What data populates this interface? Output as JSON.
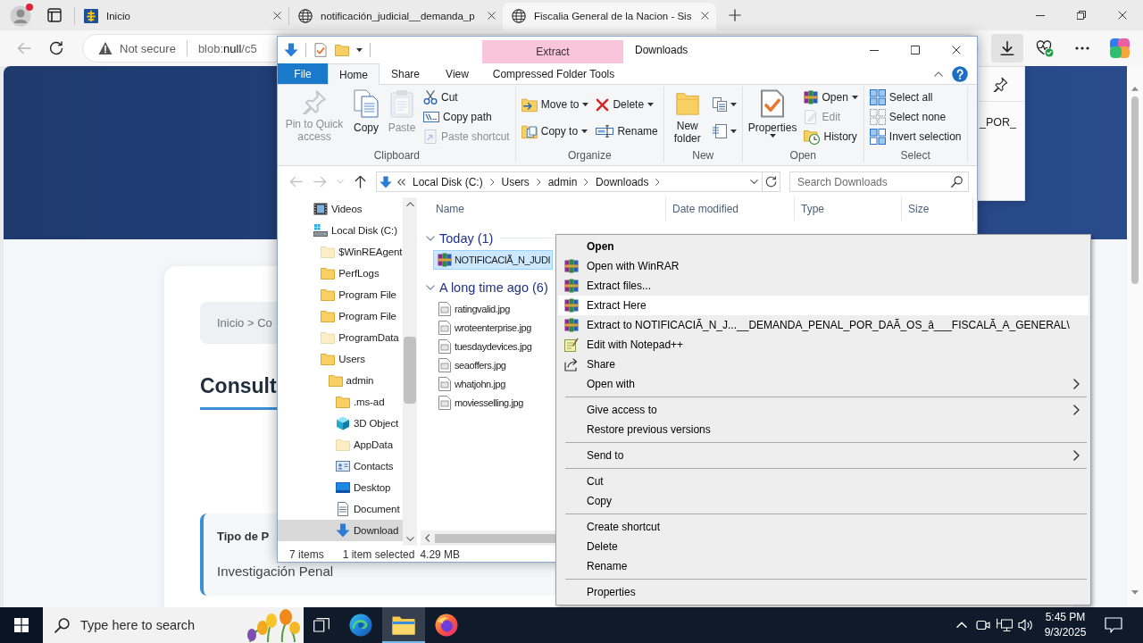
{
  "browser": {
    "tabs": [
      {
        "kind": "emblem",
        "title": "Inicio",
        "selected": false
      },
      {
        "kind": "globe",
        "title": "notificación_judicial__demanda_p",
        "selected": false
      },
      {
        "kind": "globe",
        "title": "Fiscalia General de la Nacion - Sis",
        "selected": true
      }
    ],
    "toolbar": {
      "back_disabled": true,
      "security": "Not secure",
      "url_prefix": "blob:",
      "url_host": "null",
      "url_rest": "/c5",
      "downloads_open": true
    },
    "download_flyout": {
      "text": "_POR_"
    },
    "page": {
      "breadcrumb": "Inicio > Co",
      "heading": "Consult",
      "info": {
        "label": "Tipo de P",
        "value": "Investigación Penal"
      }
    }
  },
  "explorer": {
    "title": "Downloads",
    "contextual_group": "Extract",
    "ribbon_tabs": [
      {
        "kind": "file",
        "label": "File",
        "selected": false
      },
      {
        "kind": "standard",
        "label": "Home",
        "selected": true
      },
      {
        "kind": "standard",
        "label": "Share",
        "selected": false
      },
      {
        "kind": "standard",
        "label": "View",
        "selected": false
      },
      {
        "kind": "contextual",
        "label": "Compressed Folder Tools",
        "selected": false
      }
    ],
    "ribbon_groups": [
      {
        "label": "Clipboard",
        "columns": [
          {
            "commands": [
              {
                "kind": "large",
                "label": "Pin to Quick access",
                "disabled": true,
                "dropdown": false
              }
            ]
          },
          {
            "commands": [
              {
                "kind": "large",
                "label": "Copy",
                "disabled": false,
                "dropdown": false
              }
            ]
          },
          {
            "commands": [
              {
                "kind": "large",
                "label": "Paste",
                "disabled": true,
                "dropdown": false
              }
            ]
          },
          {
            "commands": [
              {
                "kind": "small",
                "label": "Cut",
                "disabled": false,
                "dropdown": false
              },
              {
                "kind": "small",
                "label": "Copy path",
                "disabled": false,
                "dropdown": false
              },
              {
                "kind": "small",
                "label": "Paste shortcut",
                "disabled": true,
                "dropdown": false
              }
            ]
          }
        ]
      },
      {
        "label": "Organize",
        "columns": [
          {
            "commands": [
              {
                "kind": "small",
                "label": "Move to",
                "disabled": false,
                "dropdown": true
              },
              {
                "kind": "small",
                "label": "Copy to",
                "disabled": false,
                "dropdown": true
              }
            ]
          },
          {
            "commands": [
              {
                "kind": "small",
                "label": "Delete",
                "disabled": false,
                "dropdown": true
              },
              {
                "kind": "small",
                "label": "Rename",
                "disabled": false,
                "dropdown": false
              }
            ]
          }
        ]
      },
      {
        "label": "New",
        "columns": [
          {
            "commands": [
              {
                "kind": "large",
                "label": "New folder",
                "disabled": false,
                "dropdown": false
              }
            ]
          },
          {
            "commands": [
              {
                "kind": "small",
                "disabled": false,
                "dropdown": true
              },
              {
                "kind": "small",
                "disabled": false,
                "dropdown": true
              }
            ]
          }
        ]
      },
      {
        "label": "Open",
        "columns": [
          {
            "commands": [
              {
                "kind": "large",
                "label": "Properties",
                "disabled": false,
                "dropdown": true
              }
            ]
          },
          {
            "commands": [
              {
                "kind": "small",
                "label": "Open",
                "disabled": false,
                "dropdown": true
              },
              {
                "kind": "small",
                "label": "Edit",
                "disabled": true,
                "dropdown": false
              },
              {
                "kind": "small",
                "label": "History",
                "disabled": false,
                "dropdown": false
              }
            ]
          }
        ]
      },
      {
        "label": "Select",
        "columns": [
          {
            "commands": [
              {
                "kind": "small",
                "label": "Select all",
                "disabled": false,
                "dropdown": false
              },
              {
                "kind": "small",
                "label": "Select none",
                "disabled": false,
                "dropdown": false
              },
              {
                "kind": "small",
                "label": "Invert selection",
                "disabled": false,
                "dropdown": false
              }
            ]
          }
        ]
      }
    ],
    "nav_buttons": [
      {
        "kind": "back",
        "disabled": true
      },
      {
        "kind": "forward",
        "disabled": true
      },
      {
        "kind": "recent",
        "disabled": true
      },
      {
        "kind": "up",
        "disabled": false
      }
    ],
    "path": [
      "Local Disk (C:)",
      "Users",
      "admin",
      "Downloads"
    ],
    "search": {
      "placeholder": "Search Downloads"
    },
    "tree": [
      {
        "label": "Videos",
        "kind": "videos",
        "hidden": false,
        "selected": false
      },
      {
        "label": "Local Disk (C:)",
        "kind": "drive",
        "hidden": false,
        "selected": false,
        "children": [
          {
            "label": "$WinREAgent",
            "kind": "folder",
            "hidden": true,
            "selected": false
          },
          {
            "label": "PerfLogs",
            "kind": "folder",
            "hidden": false,
            "selected": false
          },
          {
            "label": "Program File",
            "kind": "folder",
            "hidden": false,
            "selected": false
          },
          {
            "label": "Program File",
            "kind": "folder",
            "hidden": false,
            "selected": false
          },
          {
            "label": "ProgramData",
            "kind": "folder",
            "hidden": true,
            "selected": false
          },
          {
            "label": "Users",
            "kind": "folder",
            "hidden": false,
            "selected": false,
            "children": [
              {
                "label": "admin",
                "kind": "folder",
                "hidden": false,
                "selected": false,
                "children": [
                  {
                    "label": ".ms-ad",
                    "kind": "folder",
                    "hidden": false,
                    "selected": false
                  },
                  {
                    "label": "3D Object",
                    "kind": "objects",
                    "hidden": false,
                    "selected": false
                  },
                  {
                    "label": "AppData",
                    "kind": "folder",
                    "hidden": true,
                    "selected": false
                  },
                  {
                    "label": "Contacts",
                    "kind": "contacts",
                    "hidden": false,
                    "selected": false
                  },
                  {
                    "label": "Desktop",
                    "kind": "desktop",
                    "hidden": false,
                    "selected": false
                  },
                  {
                    "label": "Document",
                    "kind": "documents",
                    "hidden": false,
                    "selected": false
                  },
                  {
                    "label": "Download",
                    "kind": "downloads",
                    "hidden": false,
                    "selected": true
                  }
                ]
              }
            ]
          }
        ]
      }
    ],
    "columns": [
      "Name",
      "Date modified",
      "Type",
      "Size"
    ],
    "groups": [
      {
        "label": "Today (1)",
        "expanded": true,
        "files": [
          {
            "name": "NOTIFICACIÃ_N_JUDI",
            "kind": "archive",
            "selected": true
          }
        ]
      },
      {
        "label": "A long time ago (6)",
        "expanded": true,
        "files": [
          {
            "name": "ratingvalid.jpg",
            "kind": "image",
            "selected": false
          },
          {
            "name": "wroteenterprise.jpg",
            "kind": "image",
            "selected": false
          },
          {
            "name": "tuesdaydevices.jpg",
            "kind": "image",
            "selected": false
          },
          {
            "name": "seaoffers.jpg",
            "kind": "image",
            "selected": false
          },
          {
            "name": "whatjohn.jpg",
            "kind": "image",
            "selected": false
          },
          {
            "name": "moviesselling.jpg",
            "kind": "image",
            "selected": false
          }
        ]
      }
    ],
    "status": {
      "items": "7 items",
      "selection": "1 item selected",
      "size": "4.29 MB"
    }
  },
  "context_menu": {
    "sections": [
      {
        "items": [
          {
            "label": "Open",
            "kind": "plain",
            "default": true,
            "selected": false,
            "submenu": false
          },
          {
            "label": "Open with WinRAR",
            "kind": "archiver",
            "default": false,
            "selected": false,
            "submenu": false
          },
          {
            "label": "Extract files...",
            "kind": "archiver",
            "default": false,
            "selected": false,
            "submenu": false
          },
          {
            "label": "Extract Here",
            "kind": "archiver",
            "default": false,
            "selected": true,
            "submenu": false
          },
          {
            "label": "Extract to NOTIFICACIÃ_N_J...__DEMANDA_PENAL_POR_DAÃ_OS_â___FISCALÃ_A_GENERAL\\",
            "kind": "archiver",
            "default": false,
            "selected": false,
            "submenu": false
          },
          {
            "label": "Edit with Notepad++",
            "kind": "editor",
            "default": false,
            "selected": false,
            "submenu": false
          },
          {
            "label": "Share",
            "kind": "share",
            "default": false,
            "selected": false,
            "submenu": false
          },
          {
            "label": "Open with",
            "kind": "plain",
            "default": false,
            "selected": false,
            "submenu": true
          }
        ]
      },
      {
        "items": [
          {
            "label": "Give access to",
            "kind": "plain",
            "default": false,
            "selected": false,
            "submenu": true
          },
          {
            "label": "Restore previous versions",
            "kind": "plain",
            "default": false,
            "selected": false,
            "submenu": false
          }
        ]
      },
      {
        "items": [
          {
            "label": "Send to",
            "kind": "plain",
            "default": false,
            "selected": false,
            "submenu": true
          }
        ]
      },
      {
        "items": [
          {
            "label": "Cut",
            "kind": "plain",
            "default": false,
            "selected": false,
            "submenu": false
          },
          {
            "label": "Copy",
            "kind": "plain",
            "default": false,
            "selected": false,
            "submenu": false
          }
        ]
      },
      {
        "items": [
          {
            "label": "Create shortcut",
            "kind": "plain",
            "default": false,
            "selected": false,
            "submenu": false
          },
          {
            "label": "Delete",
            "kind": "plain",
            "default": false,
            "selected": false,
            "submenu": false
          },
          {
            "label": "Rename",
            "kind": "plain",
            "default": false,
            "selected": false,
            "submenu": false
          }
        ]
      },
      {
        "items": [
          {
            "label": "Properties",
            "kind": "plain",
            "default": false,
            "selected": false,
            "submenu": false
          }
        ]
      }
    ]
  },
  "taskbar": {
    "search": {
      "placeholder": "Type here to search"
    },
    "apps": [
      {
        "kind": "taskview",
        "selected": false
      },
      {
        "kind": "edge",
        "selected": false
      },
      {
        "kind": "explorer",
        "selected": true
      },
      {
        "kind": "firefox",
        "selected": false
      }
    ],
    "clock": {
      "time": "5:45 PM",
      "date": "9/3/2025"
    }
  }
}
